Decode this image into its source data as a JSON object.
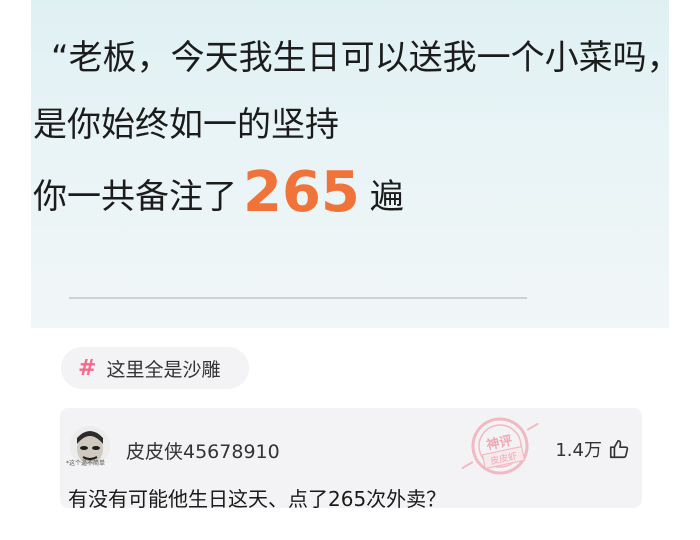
{
  "hero": {
    "line1": "“老板，今天我生日可以送我一个小菜吗，",
    "line2": "是你始终如一的坚持",
    "line3_prefix": "你一共备注了",
    "count": "265",
    "line3_suffix": "遍",
    "accent_color": "#f0733a"
  },
  "topic_tag": {
    "symbol": "#",
    "label": "这里全是沙雕",
    "symbol_color": "#f26b8a"
  },
  "comment": {
    "avatar_caption": "*这个逼不简单",
    "username": "皮皮侠45678910",
    "stamp_line1": "神评",
    "stamp_line2": "皮皮虾",
    "like_count": "1.4万",
    "text": "有没有可能他生日这天、点了265次外卖？"
  }
}
